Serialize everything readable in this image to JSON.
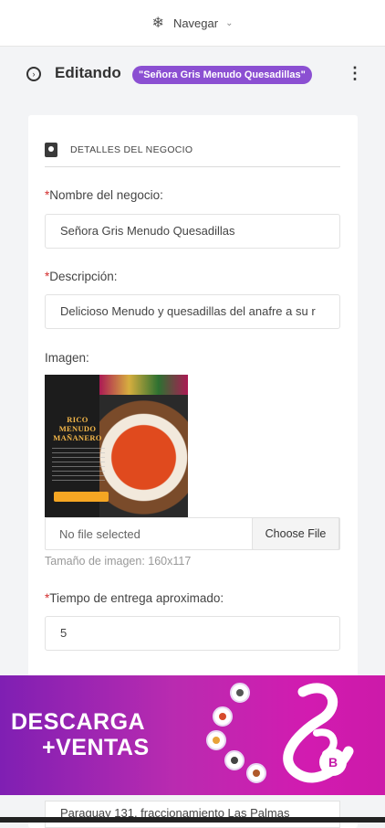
{
  "nav": {
    "label": "Navegar",
    "icon": "snowflake-icon",
    "chevron": "chevron-down-icon"
  },
  "edit": {
    "title": "Editando",
    "badge": "\"Señora Gris Menudo Quesadillas\"",
    "badge_color": "#8b4fd2"
  },
  "section": {
    "title": "DETALLES DEL NEGOCIO",
    "icon": "contact-book-icon"
  },
  "form": {
    "name_label": "Nombre del negocio:",
    "name_value": "Señora Gris Menudo Quesadillas",
    "desc_label": "Descripción:",
    "desc_value": "Delicioso Menudo y quesadillas del anafre a su r",
    "image_label": "Imagen:",
    "image_text": "RICO MENUDO MAÑANERO",
    "file_status": "No file selected",
    "file_button": "Choose File",
    "image_hint": "Tamaño de imagen: 160x117",
    "delivery_label": "Tiempo de entrega aproximado:",
    "delivery_value": "5",
    "address_value": "Paraguay 131, fraccionamiento Las Palmas",
    "required_mark": "*"
  },
  "ad": {
    "line1": "DESCARGA",
    "line2": "+VENTAS",
    "logo_letter": "B",
    "colors": {
      "start": "#7f1fb3",
      "end": "#d21bb0"
    }
  }
}
